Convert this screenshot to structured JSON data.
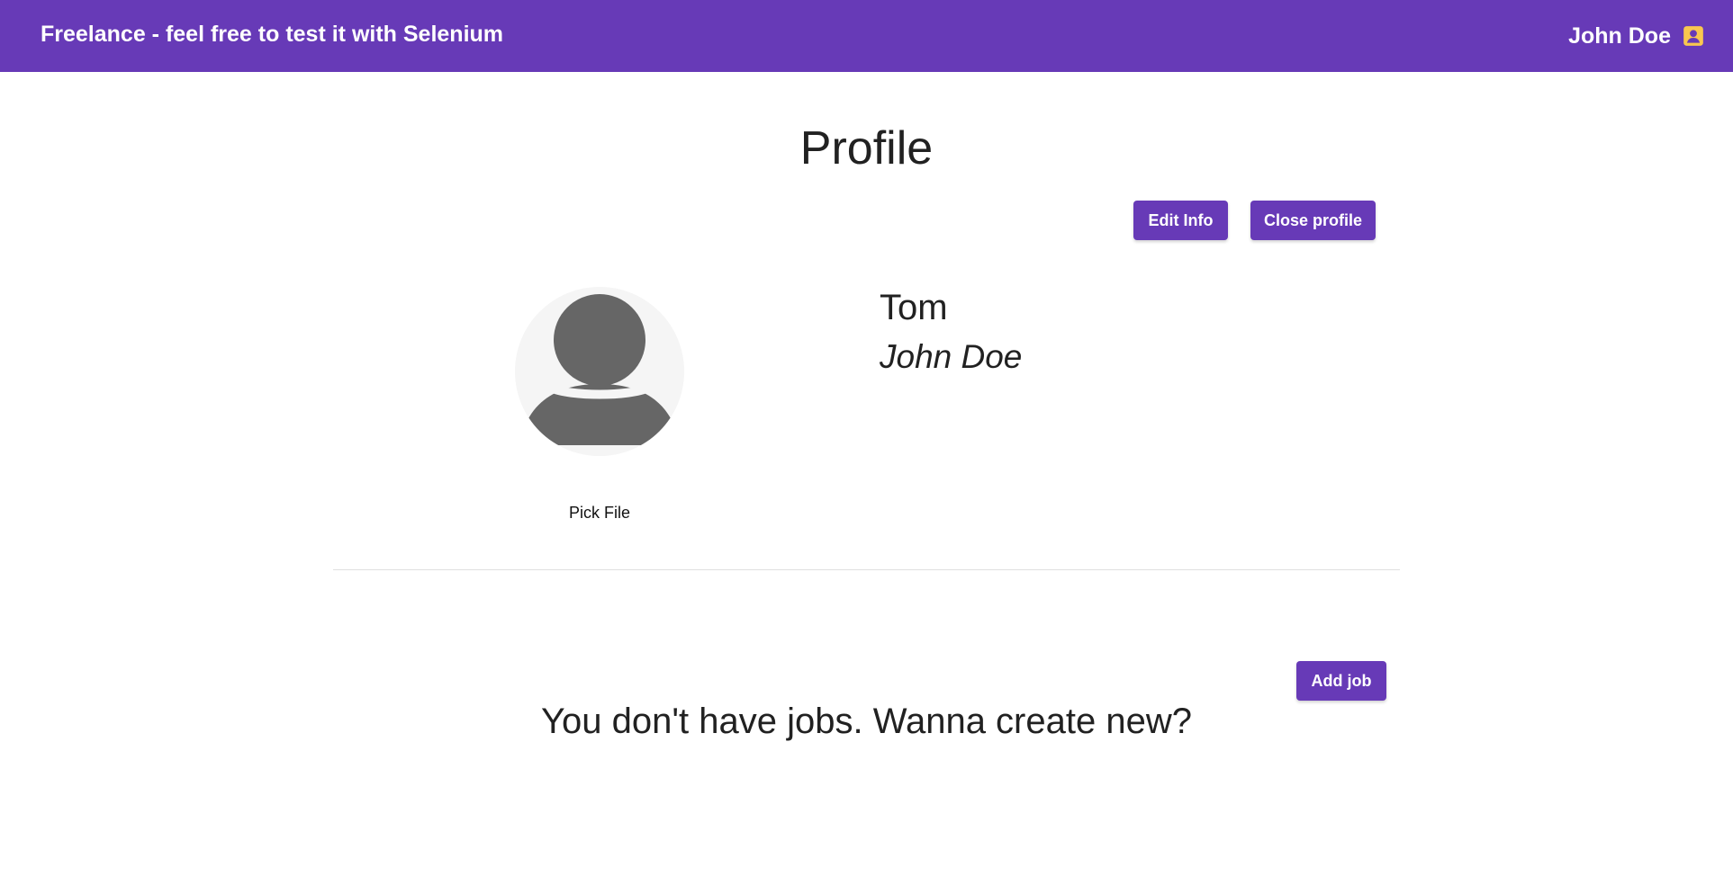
{
  "header": {
    "app_title": "Freelance - feel free to test it with Selenium",
    "user_name": "John Doe",
    "user_icon": "account-box-icon",
    "background_color": "#673ab7",
    "icon_color": "#f9c74f"
  },
  "profile": {
    "title": "Profile",
    "edit_button": "Edit Info",
    "close_button": "Close profile",
    "avatar_icon": "default-avatar-icon",
    "pick_file_label": "Pick File",
    "first_name": "Tom",
    "full_name": "John Doe"
  },
  "jobs": {
    "add_button": "Add job",
    "empty_message": "You don't have jobs. Wanna create new?"
  },
  "colors": {
    "accent": "#673ab7",
    "text": "#212121",
    "avatar_background": "#f5f5f5",
    "avatar_figure": "#666666"
  }
}
